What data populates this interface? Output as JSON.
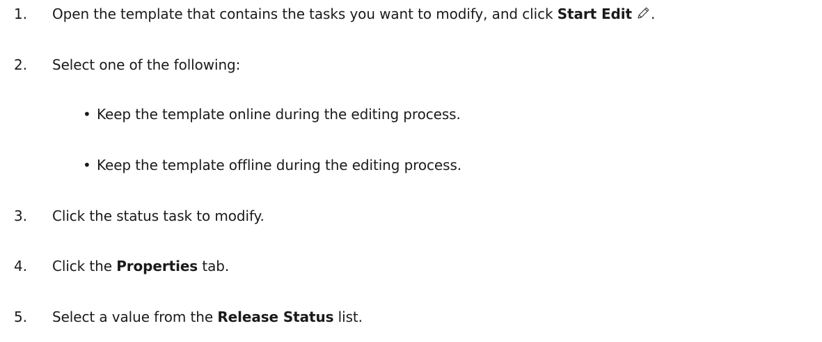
{
  "steps": [
    {
      "num": "1.",
      "text_before": "Open the template that contains the tasks you want to modify, and click ",
      "bold": "Start Edit",
      "icon": "pencil-icon",
      "text_after": "."
    },
    {
      "num": "2.",
      "text": "Select one of the following:",
      "options": [
        "Keep the template online during the editing process.",
        "Keep the template offline during the editing process."
      ]
    },
    {
      "num": "3.",
      "text": "Click the status task to modify."
    },
    {
      "num": "4.",
      "text_before": "Click the ",
      "bold": "Properties",
      "text_after": " tab."
    },
    {
      "num": "5.",
      "text_before": "Select a value from the ",
      "bold": "Release Status",
      "text_after": " list."
    }
  ],
  "bullet_char": "•"
}
